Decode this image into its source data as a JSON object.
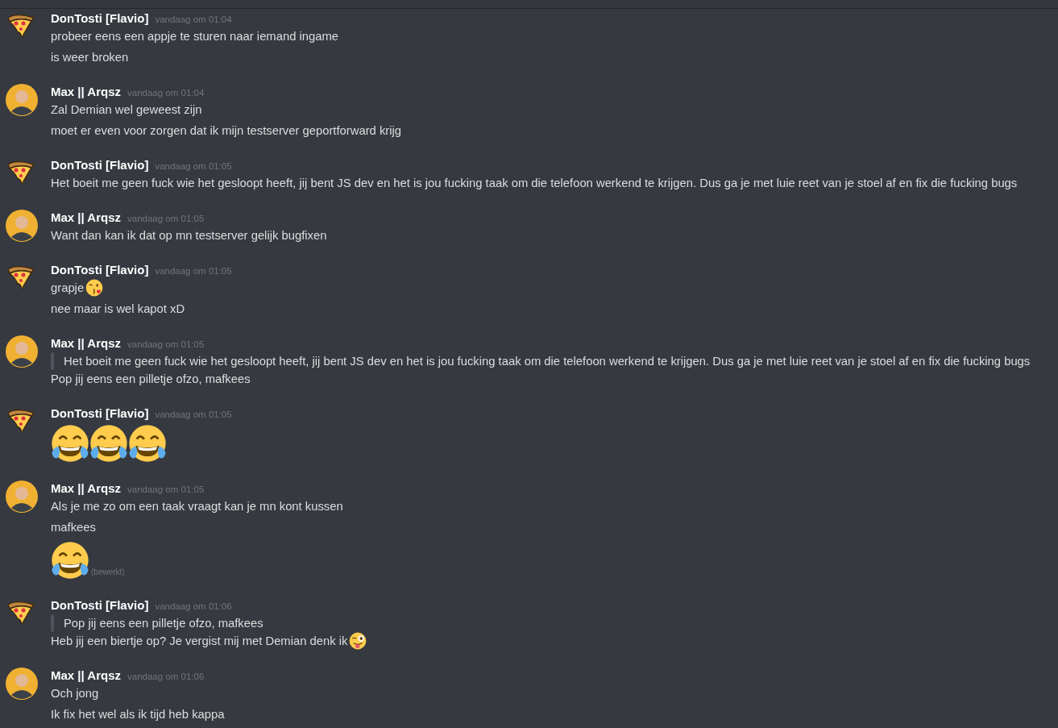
{
  "groups": [
    {
      "author": "DonTosti [Flavio]",
      "avatar": {
        "kind": "pizza"
      },
      "timestamp": "vandaag om 01:04",
      "lines": [
        {
          "kind": "text",
          "text": "probeer eens een appje te sturen naar iemand ingame"
        },
        {
          "kind": "text",
          "text": "is weer broken"
        }
      ]
    },
    {
      "author": "Max || Arqsz",
      "avatar": {
        "kind": "person"
      },
      "timestamp": "vandaag om 01:04",
      "lines": [
        {
          "kind": "text",
          "text": "Zal Demian wel geweest zijn"
        },
        {
          "kind": "text",
          "text": "moet er even voor zorgen dat ik mijn testserver geportforward krijg"
        }
      ]
    },
    {
      "author": "DonTosti [Flavio]",
      "avatar": {
        "kind": "pizza"
      },
      "timestamp": "vandaag om 01:05",
      "lines": [
        {
          "kind": "text",
          "text": "Het boeit me geen fuck wie het gesloopt heeft, jij bent JS dev en het is jou fucking taak om die telefoon werkend te krijgen. Dus ga je met luie reet van je stoel af en fix die fucking bugs"
        }
      ]
    },
    {
      "author": "Max || Arqsz",
      "avatar": {
        "kind": "person"
      },
      "timestamp": "vandaag om 01:05",
      "lines": [
        {
          "kind": "text",
          "text": "Want dan kan ik dat op mn testserver gelijk bugfixen"
        }
      ]
    },
    {
      "author": "DonTosti [Flavio]",
      "avatar": {
        "kind": "pizza"
      },
      "timestamp": "vandaag om 01:05",
      "lines": [
        {
          "kind": "text",
          "text": "grapje",
          "emojis": [
            {
              "kind": "kiss"
            }
          ]
        },
        {
          "kind": "text",
          "text": "nee maar is wel kapot xD"
        }
      ]
    },
    {
      "author": "Max || Arqsz",
      "avatar": {
        "kind": "person"
      },
      "timestamp": "vandaag om 01:05",
      "lines": [
        {
          "kind": "quote",
          "text": "Het boeit me geen fuck wie het gesloopt heeft, jij bent JS dev en het is jou fucking taak om die telefoon werkend te krijgen. Dus ga je met luie reet van je stoel af en fix die fucking bugs"
        },
        {
          "kind": "text",
          "text": "Pop jij eens een pilletje ofzo, mafkees"
        }
      ]
    },
    {
      "author": "DonTosti [Flavio]",
      "avatar": {
        "kind": "pizza"
      },
      "timestamp": "vandaag om 01:05",
      "lines": [
        {
          "kind": "jumbo",
          "emojis": [
            {
              "kind": "joy"
            },
            {
              "kind": "joy"
            },
            {
              "kind": "joy"
            }
          ]
        }
      ]
    },
    {
      "author": "Max || Arqsz",
      "avatar": {
        "kind": "person"
      },
      "timestamp": "vandaag om 01:05",
      "lines": [
        {
          "kind": "text",
          "text": "Als je me zo om een taak vraagt kan je mn kont kussen"
        },
        {
          "kind": "text",
          "text": "mafkees"
        },
        {
          "kind": "jumbo",
          "emojis": [
            {
              "kind": "joy"
            }
          ],
          "edited": "(bewerkt)"
        }
      ]
    },
    {
      "author": "DonTosti [Flavio]",
      "avatar": {
        "kind": "pizza"
      },
      "timestamp": "vandaag om 01:06",
      "lines": [
        {
          "kind": "quote",
          "text": "Pop jij eens een pilletje ofzo, mafkees"
        },
        {
          "kind": "text",
          "text": "Heb jij een biertje op? Je vergist mij met Demian denk ik",
          "emojis": [
            {
              "kind": "wink"
            }
          ]
        }
      ]
    },
    {
      "author": "Max || Arqsz",
      "avatar": {
        "kind": "person"
      },
      "timestamp": "vandaag om 01:06",
      "lines": [
        {
          "kind": "text",
          "text": "Och jong"
        },
        {
          "kind": "text",
          "text": "Ik fix het wel als ik tijd heb kappa"
        }
      ]
    }
  ]
}
